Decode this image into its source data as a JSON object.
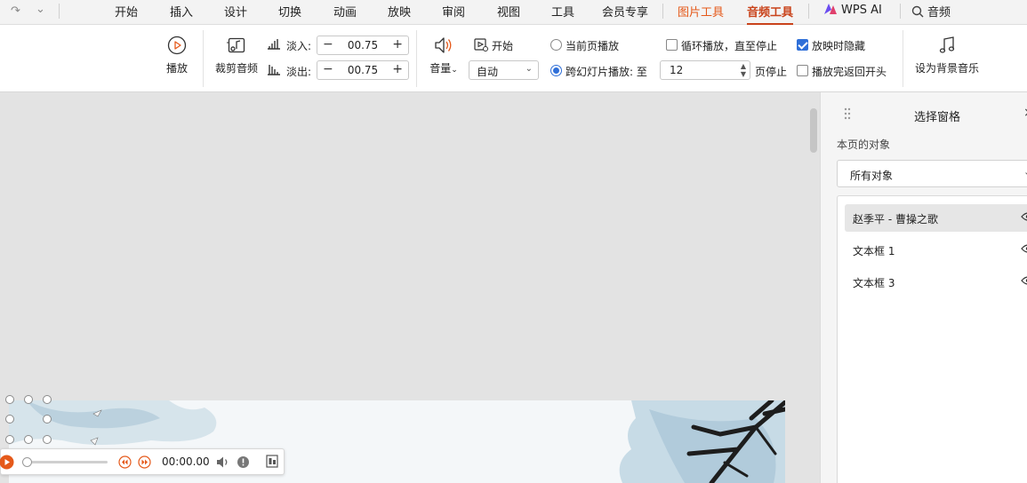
{
  "menubar": {
    "tabs": [
      {
        "label": "开始"
      },
      {
        "label": "插入"
      },
      {
        "label": "设计"
      },
      {
        "label": "切换"
      },
      {
        "label": "动画"
      },
      {
        "label": "放映"
      },
      {
        "label": "审阅"
      },
      {
        "label": "视图"
      },
      {
        "label": "工具"
      },
      {
        "label": "会员专享"
      },
      {
        "label": "图片工具"
      },
      {
        "label": "音频工具"
      },
      {
        "label": "WPS AI"
      },
      {
        "label": "音频"
      }
    ]
  },
  "ribbon": {
    "play_label": "播放",
    "trim_label": "裁剪音频",
    "fade_in_label": "淡入:",
    "fade_in_value": "00.75",
    "fade_out_label": "淡出:",
    "fade_out_value": "00.75",
    "volume_label": "音量",
    "start_label": "开始",
    "start_value": "自动",
    "current_page_label": "当前页播放",
    "cross_slide_label": "跨幻灯片播放: 至",
    "cross_slide_page": "12",
    "page_stop_label": "页停止",
    "loop_label": "循环播放，直至停止",
    "hide_label": "放映时隐藏",
    "rewind_label": "播放完返回开头",
    "bg_music_label": "设为背景音乐"
  },
  "player": {
    "time": "00:00.00"
  },
  "pane": {
    "title": "选择窗格",
    "subtitle": "本页的对象",
    "filter": "所有对象",
    "items": [
      {
        "name": "赵季平 - 曹操之歌"
      },
      {
        "name": "文本框 1"
      },
      {
        "name": "文本框 3"
      }
    ]
  },
  "colors": {
    "accent_orange": "#e5591a",
    "active_tab": "#c9431b",
    "checkbox_blue": "#2f6fd8"
  }
}
